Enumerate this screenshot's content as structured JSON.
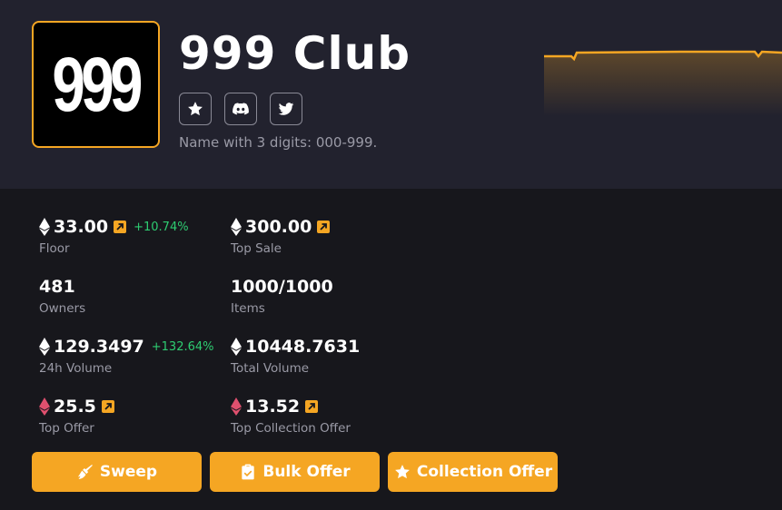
{
  "collection": {
    "logo_text": "999",
    "title": "999 Club",
    "description": "Name with 3 digits: 000-999."
  },
  "socials": [
    {
      "icon": "star-icon"
    },
    {
      "icon": "discord-icon"
    },
    {
      "icon": "twitter-icon"
    }
  ],
  "stats": {
    "floor": {
      "value": "33.00",
      "change": "+10.74%",
      "label": "Floor"
    },
    "top_sale": {
      "value": "300.00",
      "label": "Top Sale"
    },
    "owners": {
      "value": "481",
      "label": "Owners"
    },
    "items": {
      "value": "1000/1000",
      "label": "Items"
    },
    "volume_24h": {
      "value": "129.3497",
      "change": "+132.64%",
      "label": "24h Volume"
    },
    "total_volume": {
      "value": "10448.7631",
      "label": "Total Volume"
    },
    "top_offer": {
      "value": "25.5",
      "label": "Top Offer"
    },
    "top_collection_offer": {
      "value": "13.52",
      "label": "Top Collection Offer"
    }
  },
  "actions": {
    "sweep": "Sweep",
    "bulk_offer": "Bulk Offer",
    "collection_offer": "Collection Offer"
  },
  "colors": {
    "accent": "#f5a623",
    "positive": "#2ecc71",
    "offer_eth": "#e0506e"
  }
}
